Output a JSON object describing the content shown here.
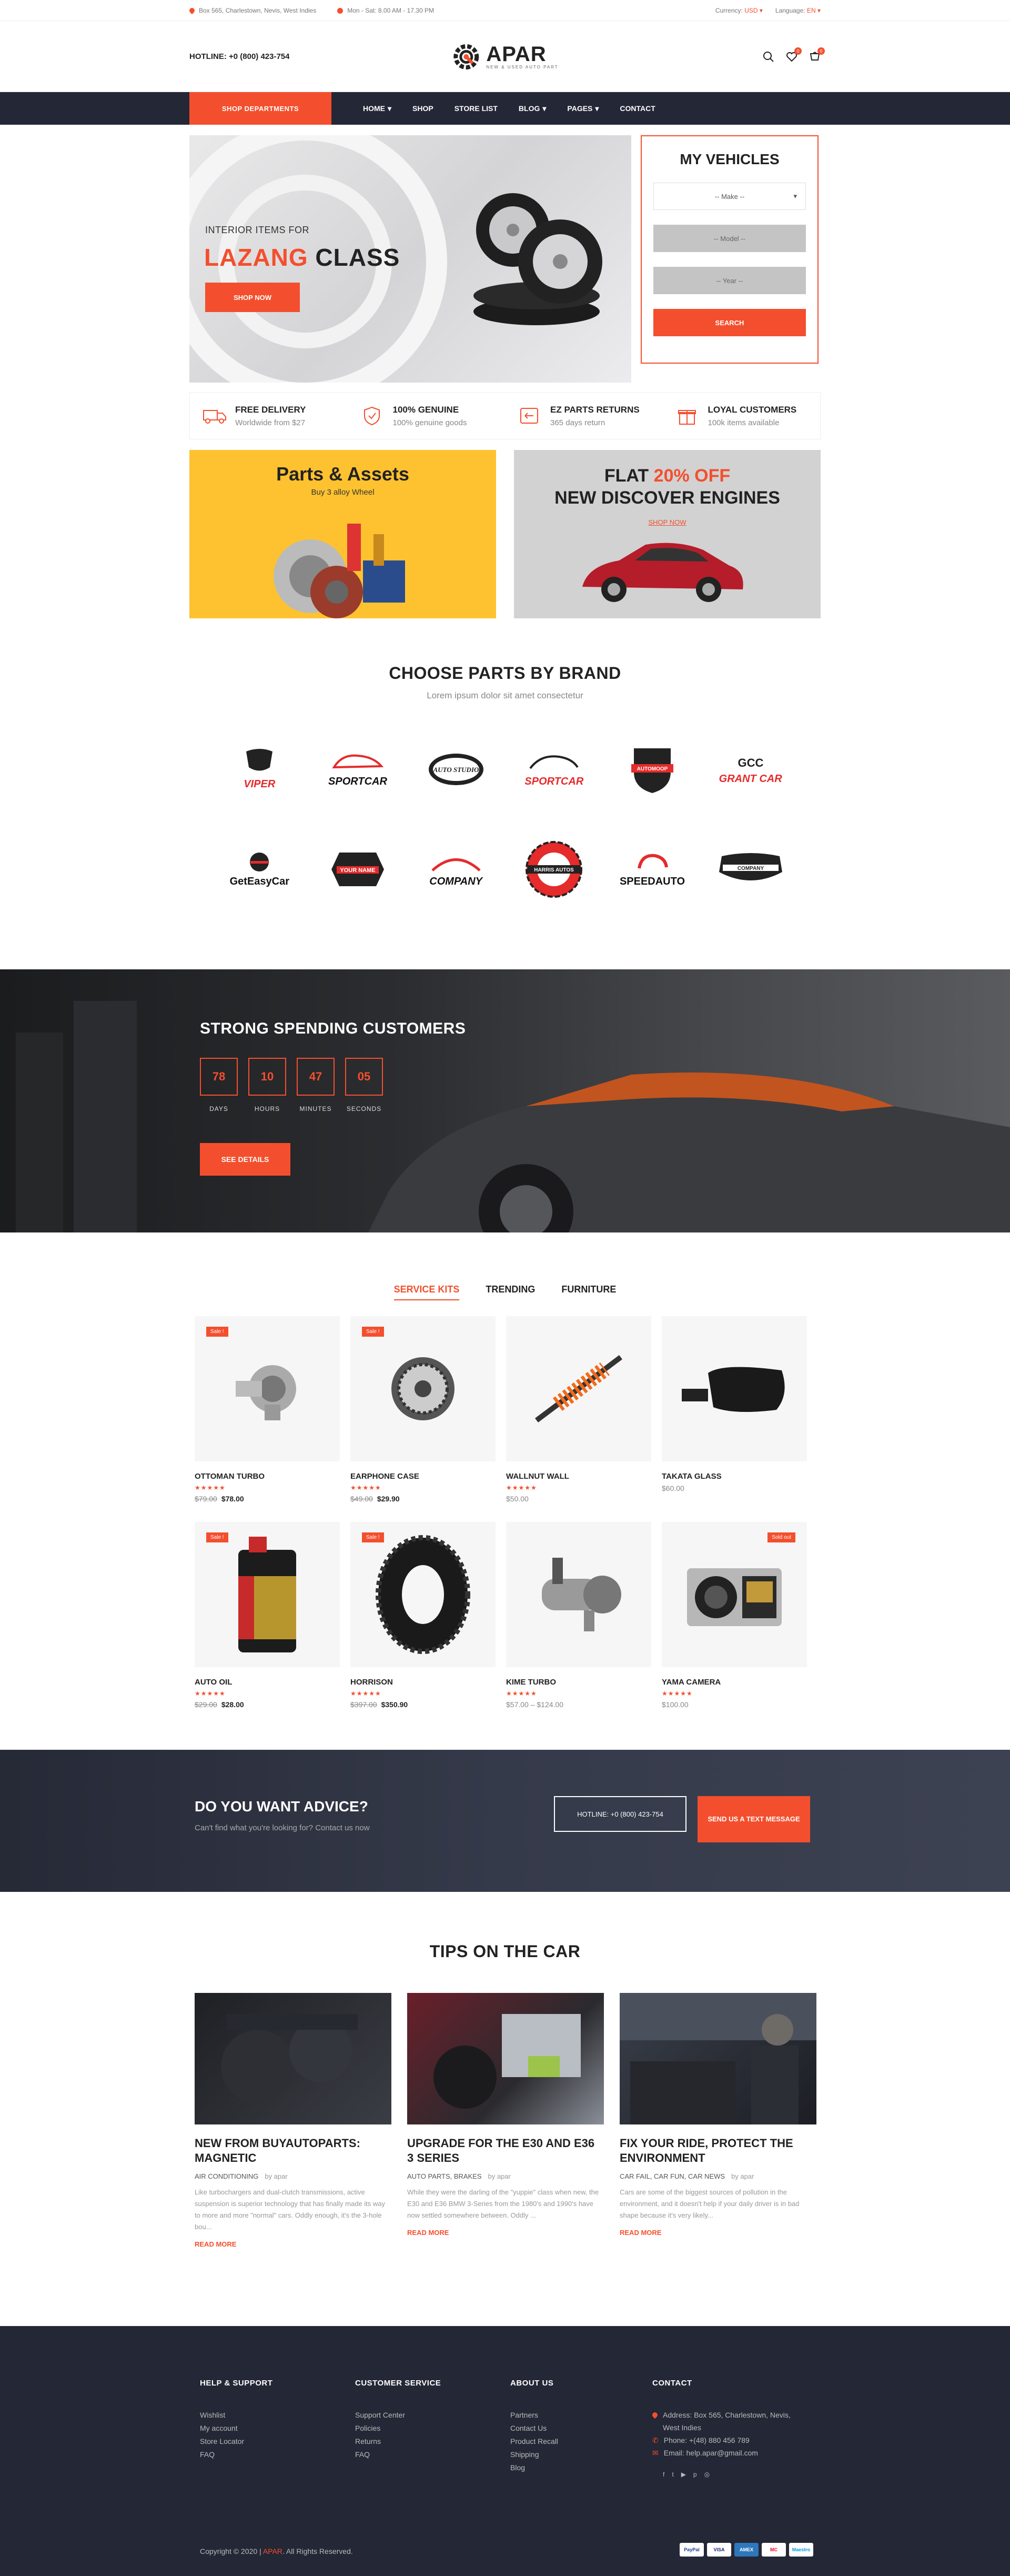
{
  "topbar": {
    "address": "Box 565, Charlestown, Nevis, West Indies",
    "hours": "Mon - Sat: 8.00 AM - 17.30 PM",
    "currency_label": "Currency:",
    "currency_value": "USD",
    "language_label": "Language:",
    "language_value": "EN"
  },
  "header": {
    "hotline": "HOTLINE: +0 (800) 423-754",
    "logo_text": "APAR",
    "logo_sub": "NEW & USED AUTO PART",
    "wishlist_count": "0",
    "cart_count": "0"
  },
  "nav": {
    "departments": "SHOP DEPARTMENTS",
    "items": [
      {
        "label": "HOME",
        "dropdown": true
      },
      {
        "label": "SHOP",
        "dropdown": false
      },
      {
        "label": "STORE LIST",
        "dropdown": false
      },
      {
        "label": "BLOG",
        "dropdown": true
      },
      {
        "label": "PAGES",
        "dropdown": true
      },
      {
        "label": "CONTACT",
        "dropdown": false
      }
    ]
  },
  "hero": {
    "pre": "INTERIOR ITEMS FOR",
    "title_highlight": "LAZANG",
    "title_rest": "CLASS",
    "button": "SHOP NOW"
  },
  "vehicles": {
    "title": "MY VEHICLES",
    "make": "-- Make --",
    "model": "-- Model --",
    "year": "-- Year --",
    "button": "SEARCH"
  },
  "features": [
    {
      "icon": "truck-icon",
      "title": "FREE DELIVERY",
      "sub": "Worldwide from $27"
    },
    {
      "icon": "shield-icon",
      "title": "100% GENUINE",
      "sub": "100% genuine goods"
    },
    {
      "icon": "return-icon",
      "title": "EZ PARTS RETURNS",
      "sub": "365 days return"
    },
    {
      "icon": "gift-icon",
      "title": "LOYAL CUSTOMERS",
      "sub": "100k items available"
    }
  ],
  "banners": {
    "b1_title": "Parts & Assets",
    "b1_sub": "Buy 3 alloy Wheel",
    "b2_flat": "FLAT",
    "b2_pct": "20% OFF",
    "b2_title": "NEW DISCOVER ENGINES",
    "b2_link": "SHOP NOW"
  },
  "brands": {
    "title": "CHOOSE PARTS BY BRAND",
    "sub": "Lorem ipsum dolor sit amet consectetur",
    "items": [
      "VIPER",
      "SPORTCAR",
      "AUTO STUDIO",
      "SPORTCAR",
      "AUTOMOOP",
      "GRANT CAR",
      "GetEasyCar",
      "YOUR NAME",
      "COMPANY",
      "HARRIS AUTOS",
      "SPEEDAUTO",
      "COMPANY"
    ]
  },
  "countdown": {
    "title": "STRONG SPENDING CUSTOMERS",
    "days": "78",
    "hours": "10",
    "minutes": "47",
    "seconds": "05",
    "days_lbl": "DAYS",
    "hours_lbl": "HOURS",
    "minutes_lbl": "MINUTES",
    "seconds_lbl": "SECONDS",
    "button": "SEE DETAILS"
  },
  "products": {
    "tabs": [
      "SERVICE KITS",
      "TRENDING",
      "FURNITURE"
    ],
    "items": [
      {
        "name": "OTTOMAN TURBO",
        "old": "$79.00",
        "price": "$78.00",
        "badge": "Sale !",
        "stars": "★★★★★"
      },
      {
        "name": "EARPHONE CASE",
        "old": "$49.00",
        "price": "$29.90",
        "badge": "Sale !",
        "stars": "★★★★★"
      },
      {
        "name": "WALLNUT WALL",
        "old": "",
        "price": "$50.00",
        "badge": "",
        "stars": "★★★★★"
      },
      {
        "name": "TAKATA GLASS",
        "old": "",
        "price": "$60.00",
        "badge": "",
        "stars": ""
      },
      {
        "name": "AUTO OIL",
        "old": "$29.00",
        "price": "$28.00",
        "badge": "Sale !",
        "stars": "★★★★★"
      },
      {
        "name": "HORRISON",
        "old": "$397.00",
        "price": "$350.90",
        "badge": "Sale !",
        "stars": "★★★★★"
      },
      {
        "name": "KIME TURBO",
        "old": "",
        "price": "$57.00 – $124.00",
        "badge": "",
        "stars": "★★★★★"
      },
      {
        "name": "YAMA CAMERA",
        "old": "",
        "price": "$100.00",
        "badge": "Sold out",
        "stars": "★★★★★"
      }
    ]
  },
  "advice": {
    "title": "DO YOU WANT ADVICE?",
    "sub": "Can't find what you're looking for? Contact us now",
    "hotline": "HOTLINE: +0 (800) 423-754",
    "button": "SEND US A TEXT MESSAGE"
  },
  "blog": {
    "title": "TIPS ON THE CAR",
    "posts": [
      {
        "title": "NEW FROM BUYAUTOPARTS: MAGNETIC",
        "cats": "AIR CONDITIONING",
        "by": "by apar",
        "excerpt": "Like turbochargers and dual-clutch transmissions, active suspension is superior technology that has finally made its way to more and more \"normal\" cars. Oddly enough, it's the 3-hole bou...",
        "more": "READ MORE"
      },
      {
        "title": "UPGRADE FOR THE E30 AND E36 3 SERIES",
        "cats": "AUTO PARTS, BRAKES",
        "by": "by apar",
        "excerpt": "While they were the darling of the \"yuppie\" class when new, the E30 and E36 BMW 3-Series from the 1980's and 1990's have now settled somewhere between. Oddly ...",
        "more": "READ MORE"
      },
      {
        "title": "FIX YOUR RIDE, PROTECT THE ENVIRONMENT",
        "cats": "CAR FAIL, CAR FUN, CAR NEWS",
        "by": "by apar",
        "excerpt": "Cars are some of the biggest sources of pollution in the environment, and it doesn't help if your daily driver is in bad shape because it's very likely...",
        "more": "READ MORE"
      }
    ]
  },
  "footer": {
    "help_title": "HELP & SUPPORT",
    "help": [
      "Wishlist",
      "My account",
      "Store Locator",
      "FAQ"
    ],
    "service_title": "CUSTOMER SERVICE",
    "service": [
      "Support Center",
      "Policies",
      "Returns",
      "FAQ"
    ],
    "about_title": "ABOUT US",
    "about": [
      "Partners",
      "Contact Us",
      "Product Recall",
      "Shipping",
      "Blog"
    ],
    "contact_title": "CONTACT",
    "address": "Address: Box 565, Charlestown, Nevis,",
    "address2": "West Indies",
    "phone": "Phone: +(48) 880 456 789",
    "email": "Email: help.apar@gmail.com",
    "copy_pre": "Copyright © 2020 |",
    "copy_brand": "APAR",
    "copy_post": ". All Rights Reserved.",
    "payments": [
      "PayPal",
      "VISA",
      "AMEX",
      "MC",
      "Maestro"
    ]
  }
}
